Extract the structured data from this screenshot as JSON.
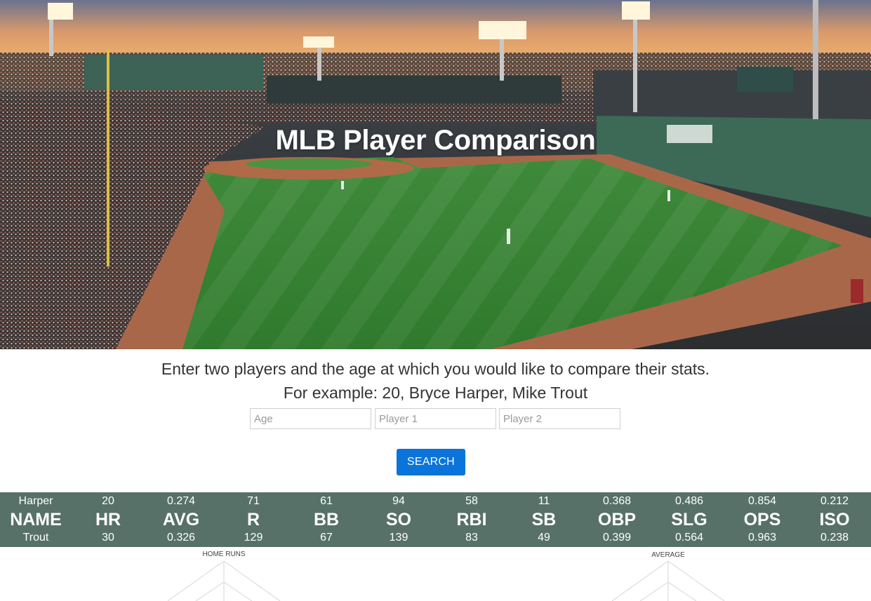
{
  "hero": {
    "title": "MLB Player Comparison"
  },
  "intro": {
    "line1": "Enter two players and the age at which you would like to compare their stats.",
    "line2": "For example: 20, Bryce Harper, Mike Trout"
  },
  "form": {
    "age_placeholder": "Age",
    "player1_placeholder": "Player 1",
    "player2_placeholder": "Player 2",
    "age_value": "",
    "player1_value": "",
    "player2_value": "",
    "search_label": "SEARCH"
  },
  "stats": {
    "columns": [
      {
        "header": "NAME",
        "player1": "Harper",
        "player2": "Trout"
      },
      {
        "header": "HR",
        "player1": "20",
        "player2": "30"
      },
      {
        "header": "AVG",
        "player1": "0.274",
        "player2": "0.326"
      },
      {
        "header": "R",
        "player1": "71",
        "player2": "129"
      },
      {
        "header": "BB",
        "player1": "61",
        "player2": "67"
      },
      {
        "header": "SO",
        "player1": "94",
        "player2": "139"
      },
      {
        "header": "RBI",
        "player1": "58",
        "player2": "83"
      },
      {
        "header": "SB",
        "player1": "11",
        "player2": "49"
      },
      {
        "header": "OBP",
        "player1": "0.368",
        "player2": "0.399"
      },
      {
        "header": "SLG",
        "player1": "0.486",
        "player2": "0.564"
      },
      {
        "header": "OPS",
        "player1": "0.854",
        "player2": "0.963"
      },
      {
        "header": "ISO",
        "player1": "0.212",
        "player2": "0.238"
      }
    ]
  },
  "charts": {
    "home_runs_label": "HOME RUNS",
    "average_label": "AVERAGE"
  },
  "colors": {
    "stats_band": "#577168",
    "search_button": "#0a74da"
  }
}
